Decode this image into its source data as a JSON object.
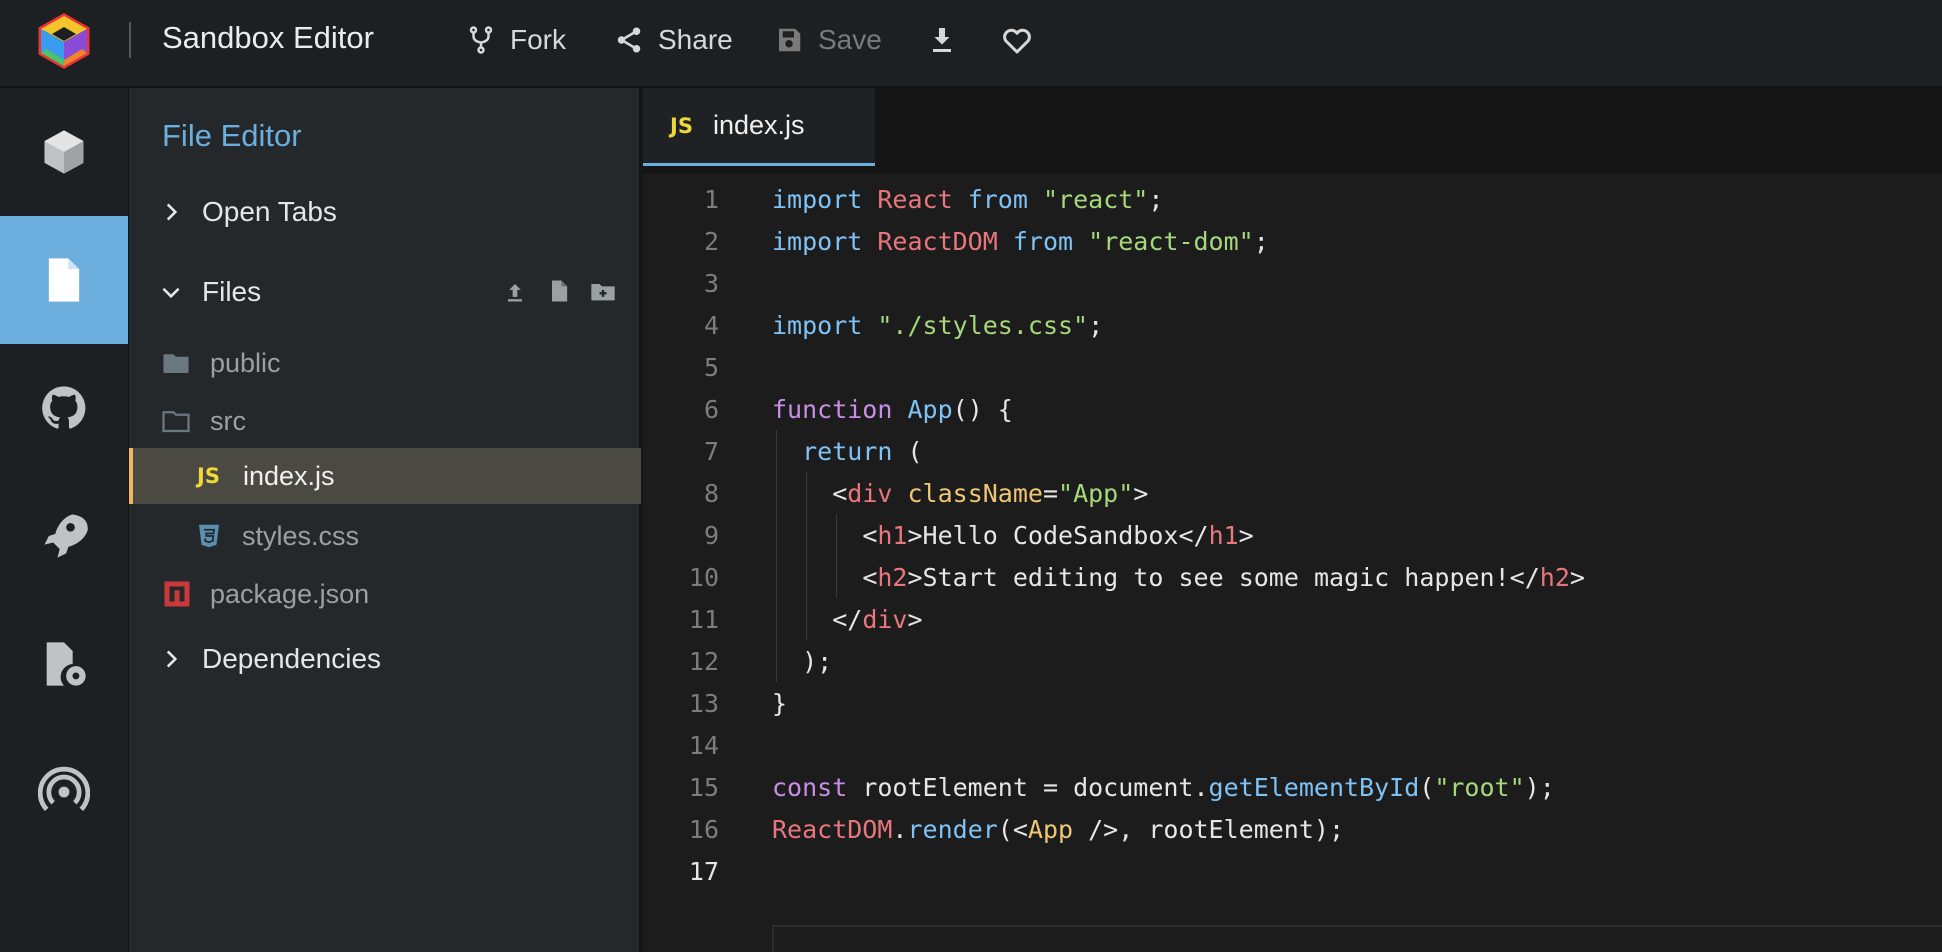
{
  "header": {
    "app_title": "Sandbox Editor",
    "fork_label": "Fork",
    "share_label": "Share",
    "save_label": "Save"
  },
  "activity_bar": {
    "items": [
      "project-info",
      "file-editor",
      "github",
      "deployment",
      "config-files",
      "live"
    ],
    "active": "file-editor"
  },
  "sidebar": {
    "title": "File Editor",
    "open_tabs_label": "Open Tabs",
    "files_label": "Files",
    "dependencies_label": "Dependencies",
    "files": [
      {
        "name": "public",
        "type": "folder-closed"
      },
      {
        "name": "src",
        "type": "folder-open"
      },
      {
        "name": "index.js",
        "type": "js",
        "badge": "JS"
      },
      {
        "name": "styles.css",
        "type": "css"
      },
      {
        "name": "package.json",
        "type": "npm"
      }
    ]
  },
  "editor": {
    "tab_label": "index.js",
    "tab_badge": "JS",
    "current_line": 17,
    "lines": [
      "import React from \"react\";",
      "import ReactDOM from \"react-dom\";",
      "",
      "import \"./styles.css\";",
      "",
      "function App() {",
      "  return (",
      "    <div className=\"App\">",
      "      <h1>Hello CodeSandbox</h1>",
      "      <h2>Start editing to see some magic happen!</h2>",
      "    </div>",
      "  );",
      "}",
      "",
      "const rootElement = document.getElementById(\"root\");",
      "ReactDOM.render(<App />, rootElement);",
      ""
    ]
  },
  "colors": {
    "accent": "#6caedd",
    "active_file_bar": "#f0b85a",
    "js_badge": "#f0d73a"
  }
}
